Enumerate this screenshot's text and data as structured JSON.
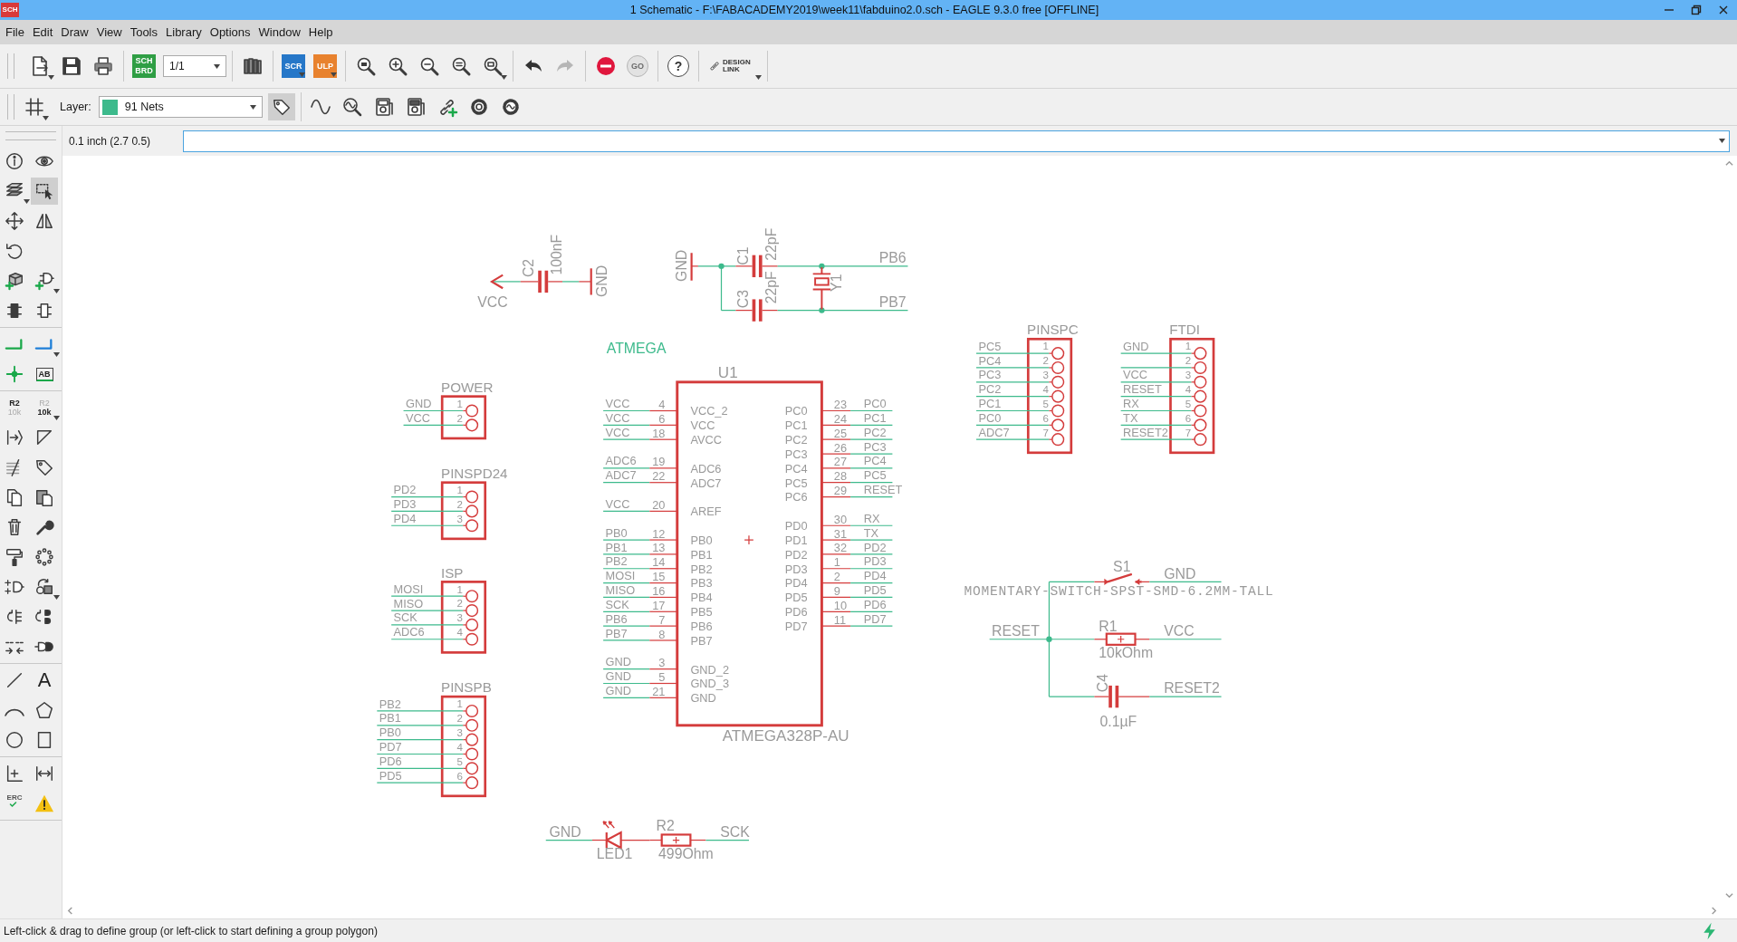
{
  "title_bar": {
    "app_icon": "SCH",
    "title": "1 Schematic - F:\\FABACADEMY2019\\week11\\fabduino2.0.sch - EAGLE 9.3.0 free [OFFLINE]"
  },
  "menu": [
    "File",
    "Edit",
    "Draw",
    "View",
    "Tools",
    "Library",
    "Options",
    "Window",
    "Help"
  ],
  "main_toolbar": [
    [
      {
        "kind": "icon",
        "disabled": false
      },
      {
        "kind": "icon",
        "disabled": false
      },
      {
        "kind": "icon",
        "disabled": false
      }
    ],
    [
      {
        "kind": "badge",
        "lines": [
          "SCH",
          "BRD"
        ],
        "color": "#2f9e44",
        "disabled": false
      },
      {
        "kind": "dropdown",
        "value": "1/1",
        "disabled": false
      }
    ],
    [
      {
        "kind": "icon",
        "disabled": false
      }
    ],
    [
      {
        "kind": "badge",
        "lines": [
          "SCR"
        ],
        "color": "#2677c8",
        "disabled": false
      },
      {
        "kind": "badge",
        "lines": [
          "ULP"
        ],
        "color": "#e8822e",
        "disabled": false
      }
    ],
    [
      {
        "kind": "icon",
        "disabled": false
      },
      {
        "kind": "icon",
        "disabled": false
      },
      {
        "kind": "icon",
        "disabled": false
      },
      {
        "kind": "icon",
        "disabled": false
      },
      {
        "kind": "icon",
        "disabled": false
      }
    ],
    [
      {
        "kind": "icon",
        "disabled": false
      },
      {
        "kind": "icon",
        "disabled": true
      }
    ],
    [
      {
        "kind": "icon",
        "disabled": false
      },
      {
        "kind": "round",
        "label": "GO",
        "disabled": true
      }
    ],
    [
      {
        "kind": "round",
        "label": "?",
        "disabled": false
      }
    ],
    [
      {
        "kind": "link",
        "lines": [
          "DESIGN",
          "LINK"
        ],
        "disabled": false
      }
    ]
  ],
  "layer_toolbar": {
    "label": "Layer:",
    "layer": {
      "value": "91 Nets",
      "color": "#3dba8c"
    },
    "tag_button": {
      "selected": true
    }
  },
  "command_line": {
    "grid": "0.1 inch (2.7 0.5)"
  },
  "tools": [
    [
      [
        {
          "selected": false
        },
        {
          "selected": false
        }
      ],
      [
        {
          "selected": false
        },
        {
          "selected": true
        }
      ],
      [
        {
          "selected": false
        },
        {
          "selected": false
        }
      ],
      [
        {
          "selected": false
        }
      ],
      [
        {
          "selected": false
        },
        {
          "selected": false
        }
      ],
      [
        {
          "selected": false
        },
        {
          "selected": false
        }
      ]
    ],
    [
      [
        {
          "selected": false
        },
        {
          "selected": false
        }
      ],
      [
        {
          "selected": false
        },
        {
          "selected": false,
          "label": "AB"
        }
      ]
    ],
    [
      [
        {
          "selected": false,
          "lines": [
            "R2",
            "10k"
          ]
        },
        {
          "selected": false,
          "lines": [
            "R2",
            "10k"
          ]
        }
      ],
      [
        {
          "selected": false
        },
        {
          "selected": false
        }
      ],
      [
        {
          "selected": false
        },
        {
          "selected": false
        }
      ],
      [
        {
          "selected": false
        },
        {
          "selected": false
        }
      ],
      [
        {
          "selected": false
        },
        {
          "selected": false
        }
      ],
      [
        {
          "selected": false
        },
        {
          "selected": false
        }
      ],
      [
        {
          "selected": false
        },
        {
          "selected": false
        }
      ],
      [
        {
          "selected": false
        },
        {
          "selected": false
        }
      ],
      [
        {
          "selected": false
        },
        {
          "selected": false
        }
      ]
    ],
    [
      [
        {
          "selected": false
        },
        {
          "selected": false,
          "label": "A"
        }
      ],
      [
        {
          "selected": false
        },
        {
          "selected": false
        }
      ],
      [
        {
          "selected": false
        },
        {
          "selected": false
        }
      ]
    ],
    [
      [
        {
          "selected": false
        },
        {
          "selected": false
        }
      ],
      [
        {
          "selected": false,
          "label": "ERC"
        },
        {
          "selected": false
        }
      ]
    ]
  ],
  "schematic": {
    "annotations": [
      {
        "text": "ATMEGA"
      }
    ],
    "circuits": [
      {
        "kind": "decoupling",
        "supply": "VCC",
        "part": "C2",
        "value": "100nF",
        "ground": "GND"
      },
      {
        "kind": "crystal",
        "ground": "GND",
        "caps": [
          {
            "part": "C1",
            "value": "22pF"
          },
          {
            "part": "C3",
            "value": "22pF"
          }
        ],
        "crystal": "Y1",
        "nets": [
          "PB6",
          "PB7"
        ]
      },
      {
        "kind": "header",
        "name": "POWER",
        "pins": [
          {
            "number": "1",
            "net": "GND"
          },
          {
            "number": "2",
            "net": "VCC"
          }
        ]
      },
      {
        "kind": "header",
        "name": "PINSPD24",
        "pins": [
          {
            "number": "1",
            "net": "PD2"
          },
          {
            "number": "2",
            "net": "PD3"
          },
          {
            "number": "3",
            "net": "PD4"
          }
        ]
      },
      {
        "kind": "header",
        "name": "ISP",
        "pins": [
          {
            "number": "1",
            "net": "MOSI"
          },
          {
            "number": "2",
            "net": "MISO"
          },
          {
            "number": "3",
            "net": "SCK"
          },
          {
            "number": "4",
            "net": "ADC6"
          }
        ]
      },
      {
        "kind": "header",
        "name": "PINSPB",
        "pins": [
          {
            "number": "1",
            "net": "PB2"
          },
          {
            "number": "2",
            "net": "PB1"
          },
          {
            "number": "3",
            "net": "PB0"
          },
          {
            "number": "4",
            "net": "PD7"
          },
          {
            "number": "5",
            "net": "PD6"
          },
          {
            "number": "6",
            "net": "PD5"
          }
        ]
      },
      {
        "kind": "ic",
        "name": "U1",
        "value": "ATMEGA328P-AU",
        "left_pins": [
          {
            "net": "VCC",
            "number": "4",
            "pin": "VCC_2"
          },
          {
            "net": "VCC",
            "number": "6",
            "pin": "VCC"
          },
          {
            "net": "VCC",
            "number": "18",
            "pin": "AVCC"
          },
          {
            "net": "ADC6",
            "number": "19",
            "pin": "ADC6"
          },
          {
            "net": "ADC7",
            "number": "22",
            "pin": "ADC7"
          },
          {
            "net": "VCC",
            "number": "20",
            "pin": "AREF"
          },
          {
            "net": "PB0",
            "number": "12",
            "pin": "PB0"
          },
          {
            "net": "PB1",
            "number": "13",
            "pin": "PB1"
          },
          {
            "net": "PB2",
            "number": "14",
            "pin": "PB2"
          },
          {
            "net": "MOSI",
            "number": "15",
            "pin": "PB3"
          },
          {
            "net": "MISO",
            "number": "16",
            "pin": "PB4"
          },
          {
            "net": "SCK",
            "number": "17",
            "pin": "PB5"
          },
          {
            "net": "PB6",
            "number": "7",
            "pin": "PB6"
          },
          {
            "net": "PB7",
            "number": "8",
            "pin": "PB7"
          },
          {
            "net": "GND",
            "number": "3",
            "pin": "GND_2"
          },
          {
            "net": "GND",
            "number": "5",
            "pin": "GND_3"
          },
          {
            "net": "GND",
            "number": "21",
            "pin": "GND"
          }
        ],
        "right_pins": [
          {
            "net": "PC0",
            "number": "23",
            "pin": "PC0"
          },
          {
            "net": "PC1",
            "number": "24",
            "pin": "PC1"
          },
          {
            "net": "PC2",
            "number": "25",
            "pin": "PC2"
          },
          {
            "net": "PC3",
            "number": "26",
            "pin": "PC3"
          },
          {
            "net": "PC4",
            "number": "27",
            "pin": "PC4"
          },
          {
            "net": "PC5",
            "number": "28",
            "pin": "PC5"
          },
          {
            "net": "RESET",
            "number": "29",
            "pin": "PC6"
          },
          {
            "net": "RX",
            "number": "30",
            "pin": "PD0"
          },
          {
            "net": "TX",
            "number": "31",
            "pin": "PD1"
          },
          {
            "net": "PD2",
            "number": "32",
            "pin": "PD2"
          },
          {
            "net": "PD3",
            "number": "1",
            "pin": "PD3"
          },
          {
            "net": "PD4",
            "number": "2",
            "pin": "PD4"
          },
          {
            "net": "PD5",
            "number": "9",
            "pin": "PD5"
          },
          {
            "net": "PD6",
            "number": "10",
            "pin": "PD6"
          },
          {
            "net": "PD7",
            "number": "11",
            "pin": "PD7"
          }
        ]
      },
      {
        "kind": "header",
        "name": "PINSPC",
        "pins": [
          {
            "number": "1",
            "net": "PC5"
          },
          {
            "number": "2",
            "net": "PC4"
          },
          {
            "number": "3",
            "net": "PC3"
          },
          {
            "number": "4",
            "net": "PC2"
          },
          {
            "number": "5",
            "net": "PC1"
          },
          {
            "number": "6",
            "net": "PC0"
          },
          {
            "number": "7",
            "net": "ADC7"
          }
        ]
      },
      {
        "kind": "header",
        "name": "FTDI",
        "pins": [
          {
            "number": "1",
            "net": "GND"
          },
          {
            "number": "2"
          },
          {
            "number": "3",
            "net": "VCC"
          },
          {
            "number": "4",
            "net": "RESET"
          },
          {
            "number": "5",
            "net": "RX"
          },
          {
            "number": "6",
            "net": "TX"
          },
          {
            "number": "7",
            "net": "RESET2"
          }
        ]
      },
      {
        "kind": "reset",
        "input": "RESET",
        "switch": {
          "part": "S1",
          "value": "MOMENTARY-SWITCH-SPST-SMD-6.2MM-TALL",
          "net": "GND"
        },
        "resistor": {
          "part": "R1",
          "value": "10kOhm",
          "net": "VCC"
        },
        "capacitor": {
          "part": "C4",
          "value": "0.1µF",
          "net": "RESET2"
        }
      },
      {
        "kind": "led",
        "ground": "GND",
        "led": "LED1",
        "resistor": {
          "part": "R2",
          "value": "499Ohm"
        },
        "net": "SCK"
      }
    ]
  },
  "status_bar": {
    "message": "Left-click & drag to define group (or left-click to start defining a group polygon)"
  }
}
